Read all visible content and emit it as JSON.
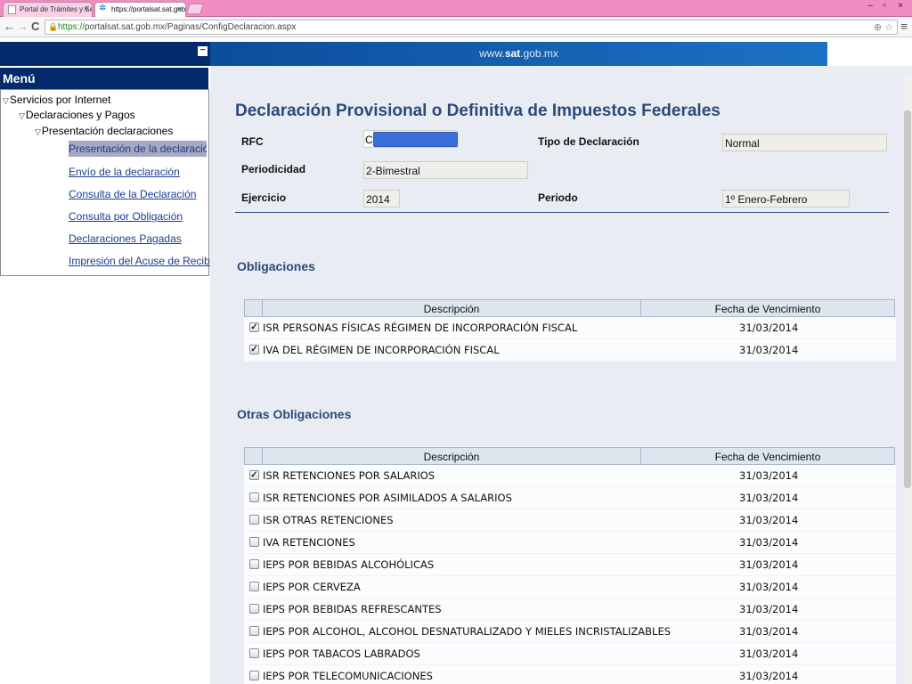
{
  "browser": {
    "tabs": [
      {
        "title": "Portal de Trámites y Servi",
        "close": "×"
      },
      {
        "title": "https://portalsat.sat.gob.m",
        "close": "×"
      }
    ],
    "window_controls": [
      "–",
      "▫",
      "×"
    ],
    "url_https": "https://",
    "url_rest": "portalsat.sat.gob.mx/Paginas/ConfigDeclaracion.aspx",
    "nav": {
      "back": "←",
      "forward": "→",
      "reload": "C"
    },
    "omnibox_icons": "⊕ ☆",
    "menu": "≡"
  },
  "site": {
    "url_prefix": "www.",
    "url_brand": "sat",
    "url_suffix": ".gob.mx",
    "collapse": "−"
  },
  "menu": {
    "header": "Menú",
    "tree": {
      "root": "Servicios por Internet",
      "level1": "Declaraciones y Pagos",
      "level2": "Presentación declaraciones",
      "links": [
        "Presentación de la declaración",
        "Envío de la declaración",
        "Consulta de la Declaración",
        "Consulta por Obligación",
        "Declaraciones Pagadas",
        "Impresión del Acuse de Recibo"
      ]
    }
  },
  "form": {
    "title": "Declaración Provisional o Definitiva de Impuestos Federales",
    "rfc_label": "RFC",
    "rfc_value_start": "C",
    "tipo_label": "Tipo de Declaración",
    "tipo_value": "Normal",
    "periodicidad_label": "Periodicidad",
    "periodicidad_value": "2-Bimestral",
    "ejercicio_label": "Ejercicio",
    "ejercicio_value": "2014",
    "periodo_label": "Periodo",
    "periodo_value": "1º Enero-Febrero"
  },
  "obligaciones": {
    "title": "Obligaciones",
    "headers": {
      "descripcion": "Descripción",
      "fecha": "Fecha de Vencimiento"
    },
    "rows": [
      {
        "desc": "ISR PERSONAS FÍSICAS RÉGIMEN DE INCORPORACIÓN FISCAL",
        "fecha": "31/03/2014",
        "checked": "✓"
      },
      {
        "desc": "IVA DEL RÉGIMEN DE INCORPORACIÓN FISCAL",
        "fecha": "31/03/2014",
        "checked": "✓"
      }
    ]
  },
  "otras": {
    "title": "Otras Obligaciones",
    "headers": {
      "descripcion": "Descripción",
      "fecha": "Fecha de Vencimiento"
    },
    "rows": [
      {
        "desc": "ISR RETENCIONES POR SALARIOS",
        "fecha": "31/03/2014",
        "checked": "✓"
      },
      {
        "desc": "ISR RETENCIONES POR ASIMILADOS A SALARIOS",
        "fecha": "31/03/2014",
        "checked": ""
      },
      {
        "desc": "ISR OTRAS RETENCIONES",
        "fecha": "31/03/2014",
        "checked": ""
      },
      {
        "desc": "IVA RETENCIONES",
        "fecha": "31/03/2014",
        "checked": ""
      },
      {
        "desc": "IEPS POR BEBIDAS ALCOHÓLICAS",
        "fecha": "31/03/2014",
        "checked": ""
      },
      {
        "desc": "IEPS POR CERVEZA",
        "fecha": "31/03/2014",
        "checked": ""
      },
      {
        "desc": "IEPS POR BEBIDAS REFRESCANTES",
        "fecha": "31/03/2014",
        "checked": ""
      },
      {
        "desc": "IEPS POR ALCOHOL, ALCOHOL DESNATURALIZADO Y MIELES INCRISTALIZABLES",
        "fecha": "31/03/2014",
        "checked": ""
      },
      {
        "desc": "IEPS POR TABACOS LABRADOS",
        "fecha": "31/03/2014",
        "checked": ""
      },
      {
        "desc": "IEPS POR TELECOMUNICACIONES",
        "fecha": "31/03/2014",
        "checked": ""
      }
    ]
  }
}
